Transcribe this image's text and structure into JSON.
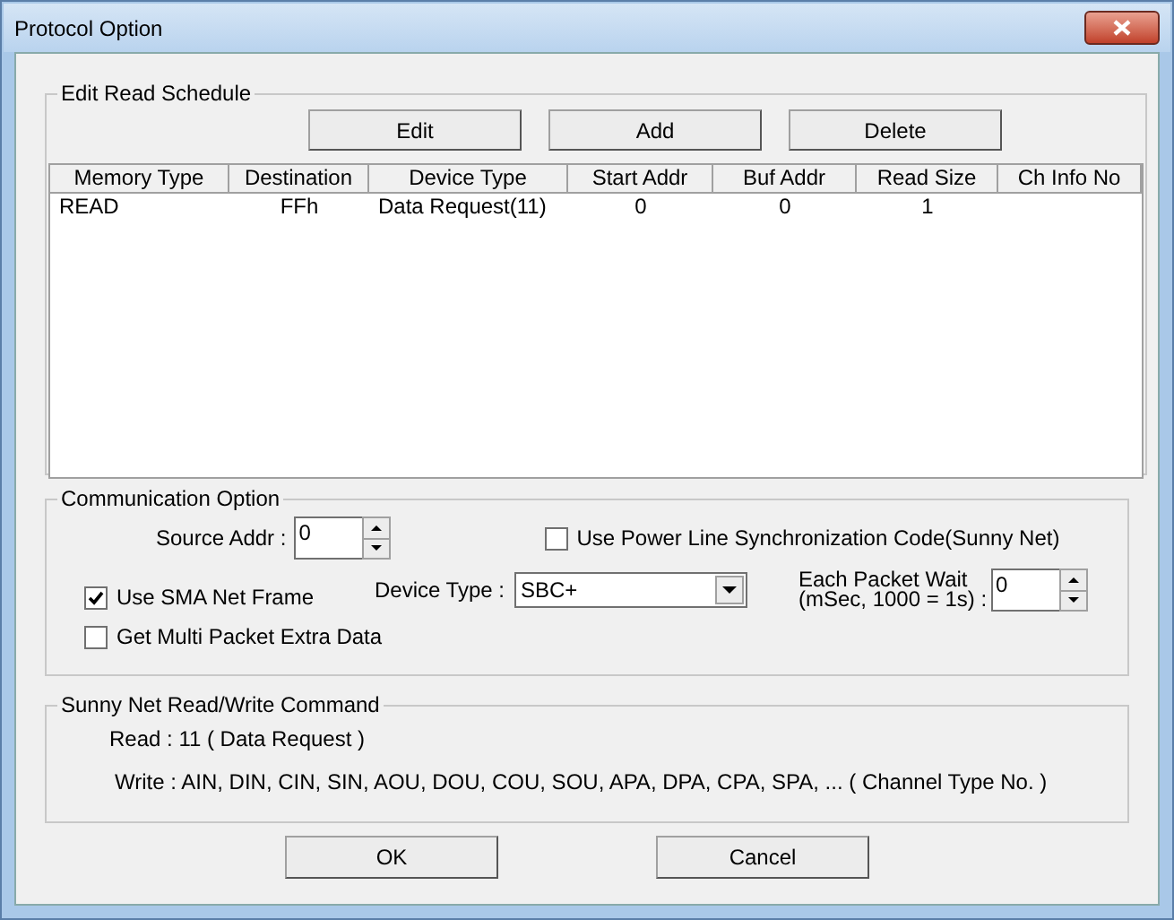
{
  "window": {
    "title": "Protocol Option"
  },
  "schedule": {
    "title": "Edit Read Schedule",
    "buttons": [
      "Edit",
      "Add",
      "Delete"
    ],
    "columns": [
      "Memory Type",
      "Destination",
      "Device Type",
      "Start Addr",
      "Buf Addr",
      "Read Size",
      "Ch Info No"
    ],
    "rows": [
      [
        "READ",
        "FFh",
        "Data Request(11)",
        "0",
        "0",
        "1",
        ""
      ]
    ]
  },
  "communication": {
    "title": "Communication Option",
    "source_addr": {
      "label": "Source Addr :",
      "value": "0"
    },
    "power_line": {
      "label": "Use Power Line Synchronization Code(Sunny Net)",
      "checked": false
    },
    "sma_frame": {
      "label": "Use SMA Net Frame",
      "checked": true
    },
    "device_type": {
      "label": "Device Type :",
      "value": "SBC+"
    },
    "packet_wait": {
      "label": [
        "Each Packet Wait",
        "(mSec, 1000 = 1s) :"
      ],
      "value": "0"
    },
    "multi_packet": {
      "label": "Get Multi Packet Extra Data",
      "checked": false
    }
  },
  "command": {
    "title": "Sunny Net Read/Write Command",
    "lines": [
      "Read : 11 ( Data Request )",
      "Write : AIN, DIN, CIN, SIN, AOU, DOU, COU, SOU, APA, DPA, CPA, SPA, ... ( Channel Type No. )"
    ]
  },
  "buttons": [
    "OK",
    "Cancel"
  ]
}
